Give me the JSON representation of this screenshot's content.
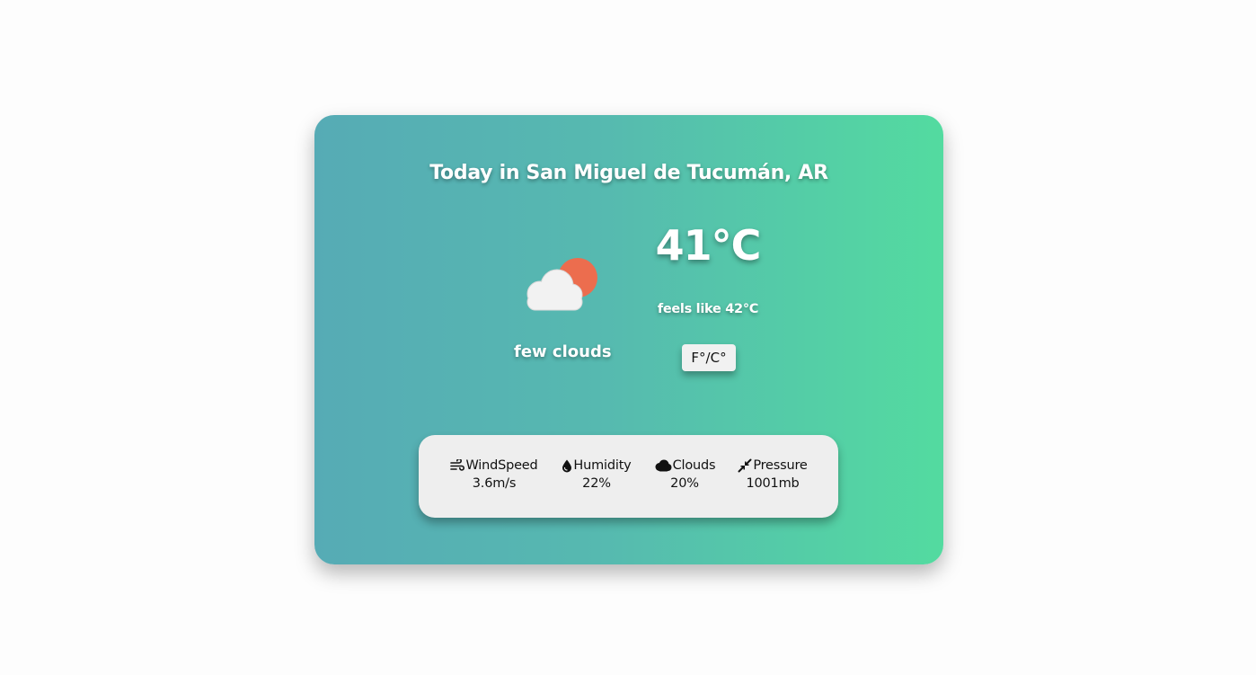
{
  "header": {
    "title": "Today in San Miguel de Tucumán, AR"
  },
  "current": {
    "icon": "few-clouds-day-icon",
    "description": "few clouds",
    "temperature": "41°C",
    "feels_like": "feels like 42°C",
    "unit_toggle_label": "F°/C°"
  },
  "stats": {
    "wind": {
      "icon": "wind-icon",
      "label": "WindSpeed",
      "value": "3.6m/s"
    },
    "humidity": {
      "icon": "droplet-icon",
      "label": "Humidity",
      "value": "22%"
    },
    "clouds": {
      "icon": "cloud-icon",
      "label": "Clouds",
      "value": "20%"
    },
    "pressure": {
      "icon": "compress-arrows-icon",
      "label": "Pressure",
      "value": "1001mb"
    }
  },
  "colors": {
    "gradient_start": "#56abb5",
    "gradient_end": "#53dba0",
    "sun": "#ec6d4e",
    "cloud": "#f2f2f2",
    "panel": "#eeeeee"
  }
}
